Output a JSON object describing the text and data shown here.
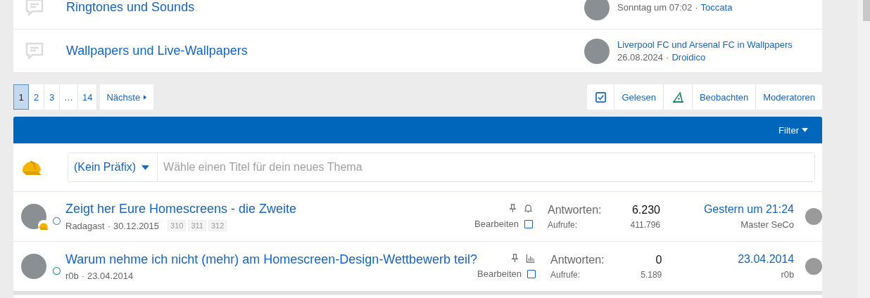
{
  "nodes": [
    {
      "title": "Ringtones und Sounds",
      "latest": {
        "date": "Sonntag um 07:02",
        "sep": "·",
        "user": "Toccata"
      }
    },
    {
      "title": "Wallpapers und Live-Wallpapers",
      "latest": {
        "title": "Liverpool FC und Arsenal FC in Wallpapers",
        "date": "26.08.2024",
        "sep": "·",
        "user": "Droidico"
      }
    }
  ],
  "pagination": {
    "pages": [
      {
        "label": "1",
        "selected": true
      },
      {
        "label": "2",
        "selected": false
      },
      {
        "label": "3",
        "selected": false
      },
      {
        "label": "…",
        "selected": false
      },
      {
        "label": "14",
        "selected": false
      }
    ],
    "next": "Nächste"
  },
  "actions": [
    {
      "kind": "checkbox",
      "label": "Gelesen"
    },
    {
      "kind": "hat",
      "label": "Beobachten"
    },
    {
      "kind": "text",
      "label": "Moderatoren"
    }
  ],
  "filter": {
    "label": "Filter"
  },
  "new_thread": {
    "prefix": "(Kein Präfix)",
    "placeholder": "Wähle einen Titel für dein neues Thema"
  },
  "threads": [
    {
      "title": "Zeigt her Eure Homescreens - die Zweite",
      "author": "Radagast",
      "sep": "·",
      "date": "30.12.2015",
      "pages": [
        "310",
        "311",
        "312"
      ],
      "avatar_badge": true,
      "status_icons": [
        {
          "kind": "pin"
        },
        {
          "kind": "bell"
        }
      ],
      "edit_label": "Bearbeiten",
      "selected": false,
      "replies_label": "Antworten:",
      "replies": "6.230",
      "views_label": "Aufrufe:",
      "views": "411.796",
      "last_date": "Gestern um 21:24",
      "last_user": "Master SeCo"
    },
    {
      "title": "Warum nehme ich nicht (mehr) am Homescreen-Design-Wettbewerb teil?",
      "author": "r0b",
      "sep": "·",
      "date": "23.04.2014",
      "avatar_badge": false,
      "status_icons": [
        {
          "kind": "pin"
        },
        {
          "kind": "chart"
        }
      ],
      "edit_label": "Bearbeiten",
      "selected": false,
      "replies_label": "Antworten:",
      "replies": "0",
      "views_label": "Aufrufe:",
      "views": "5.189",
      "last_date": "23.04.2014",
      "last_user": "r0b"
    }
  ]
}
